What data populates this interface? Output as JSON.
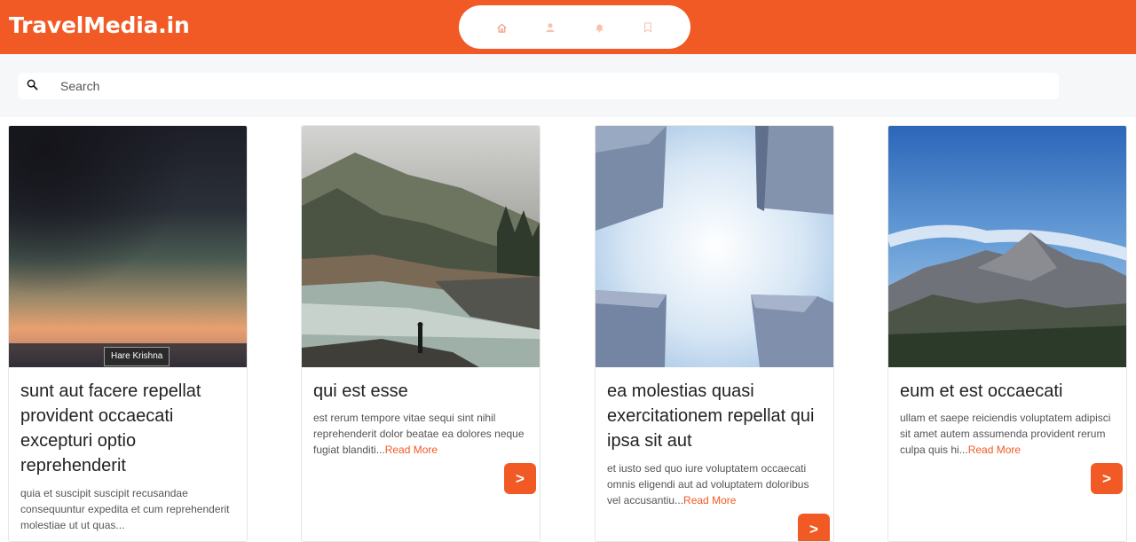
{
  "header": {
    "brand": "TravelMedia.in",
    "nav": [
      {
        "name": "home-icon"
      },
      {
        "name": "user-icon"
      },
      {
        "name": "bell-icon"
      },
      {
        "name": "bookmark-icon"
      }
    ],
    "colors": {
      "accent": "#f15a24",
      "nav_active": "#f4a384",
      "nav_inactive": "#f8c2ad"
    }
  },
  "search": {
    "placeholder": "Search",
    "value": ""
  },
  "posts": [
    {
      "title": "sunt aut facere repellat provident occaecati excepturi optio reprehenderit",
      "body": "quia et suscipit suscipit recusandae consequuntur expedita et cum reprehenderit molestiae ut ut quas...",
      "read_more": "",
      "caption": "Hare Krishna",
      "button": ">"
    },
    {
      "title": "qui est esse",
      "body": "est rerum tempore vitae sequi sint nihil reprehenderit dolor beatae ea dolores neque fugiat blanditi...",
      "read_more": "Read More",
      "button": ">"
    },
    {
      "title": "ea molestias quasi exercitationem repellat qui ipsa sit aut",
      "body": "et iusto sed quo iure voluptatem occaecati omnis eligendi aut ad voluptatem doloribus vel accusantiu...",
      "read_more": "Read More",
      "button": ">"
    },
    {
      "title": "eum et est occaecati",
      "body": "ullam et saepe reiciendis voluptatem adipisci sit amet autem assumenda provident rerum culpa quis hi...",
      "read_more": "Read More",
      "button": ">"
    }
  ]
}
